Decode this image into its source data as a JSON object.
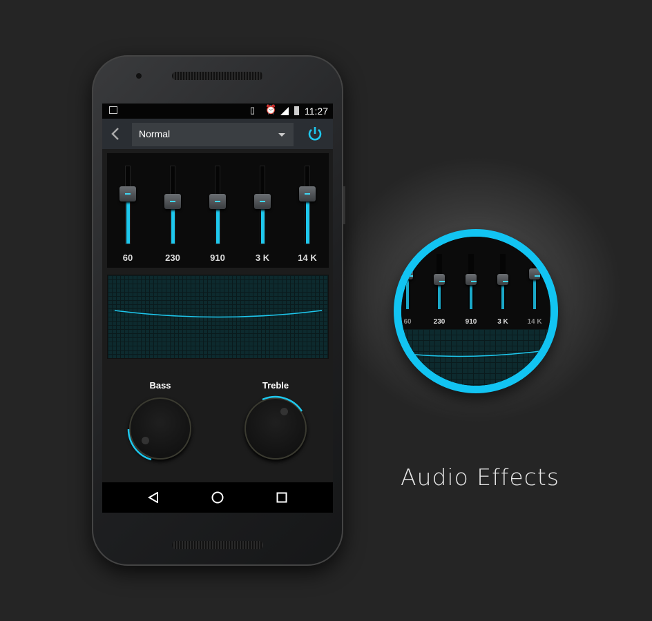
{
  "status_bar": {
    "time": "11:27",
    "icons": [
      "image-icon",
      "vibrate-icon",
      "alarm-icon",
      "signal-icon",
      "battery-charging-icon"
    ]
  },
  "toolbar": {
    "back_icon": "chevron-left-icon",
    "preset": "Normal",
    "dropdown_icon": "caret-down-icon",
    "power_icon": "power-icon",
    "accent": "#1ec8ee"
  },
  "equalizer": {
    "bands": [
      {
        "label": "60",
        "level": 0.64
      },
      {
        "label": "230",
        "level": 0.54
      },
      {
        "label": "910",
        "level": 0.54
      },
      {
        "label": "3 K",
        "level": 0.54
      },
      {
        "label": "14 K",
        "level": 0.64
      }
    ]
  },
  "bass": {
    "label": "Bass",
    "level": 0.3
  },
  "treble": {
    "label": "Treble",
    "level": 0.7
  },
  "nav": {
    "back": "triangle-back-icon",
    "home": "circle-home-icon",
    "recents": "square-recents-icon"
  },
  "caption": "Audio Effects"
}
